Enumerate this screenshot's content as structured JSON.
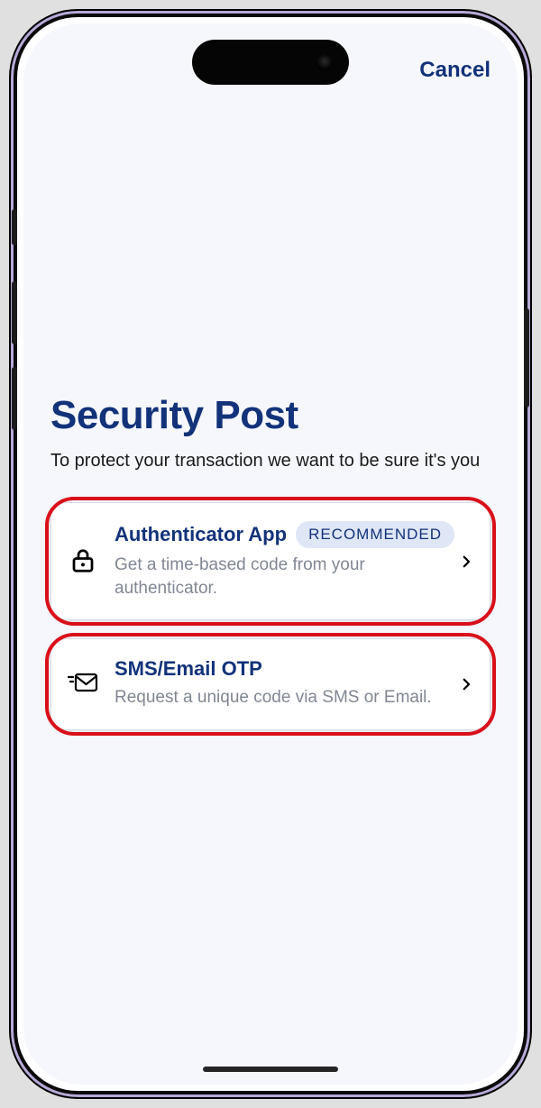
{
  "header": {
    "cancel_label": "Cancel"
  },
  "page": {
    "title": "Security Post",
    "subtitle": "To protect your transaction we want to be sure it's you"
  },
  "options": {
    "0": {
      "icon": "lock-icon",
      "title": "Authenticator App",
      "badge": "RECOMMENDED",
      "desc": "Get a time-based code from your authenticator."
    },
    "1": {
      "icon": "mail-send-icon",
      "title": "SMS/Email OTP",
      "badge": "",
      "desc": "Request a unique code via SMS or Email."
    }
  }
}
